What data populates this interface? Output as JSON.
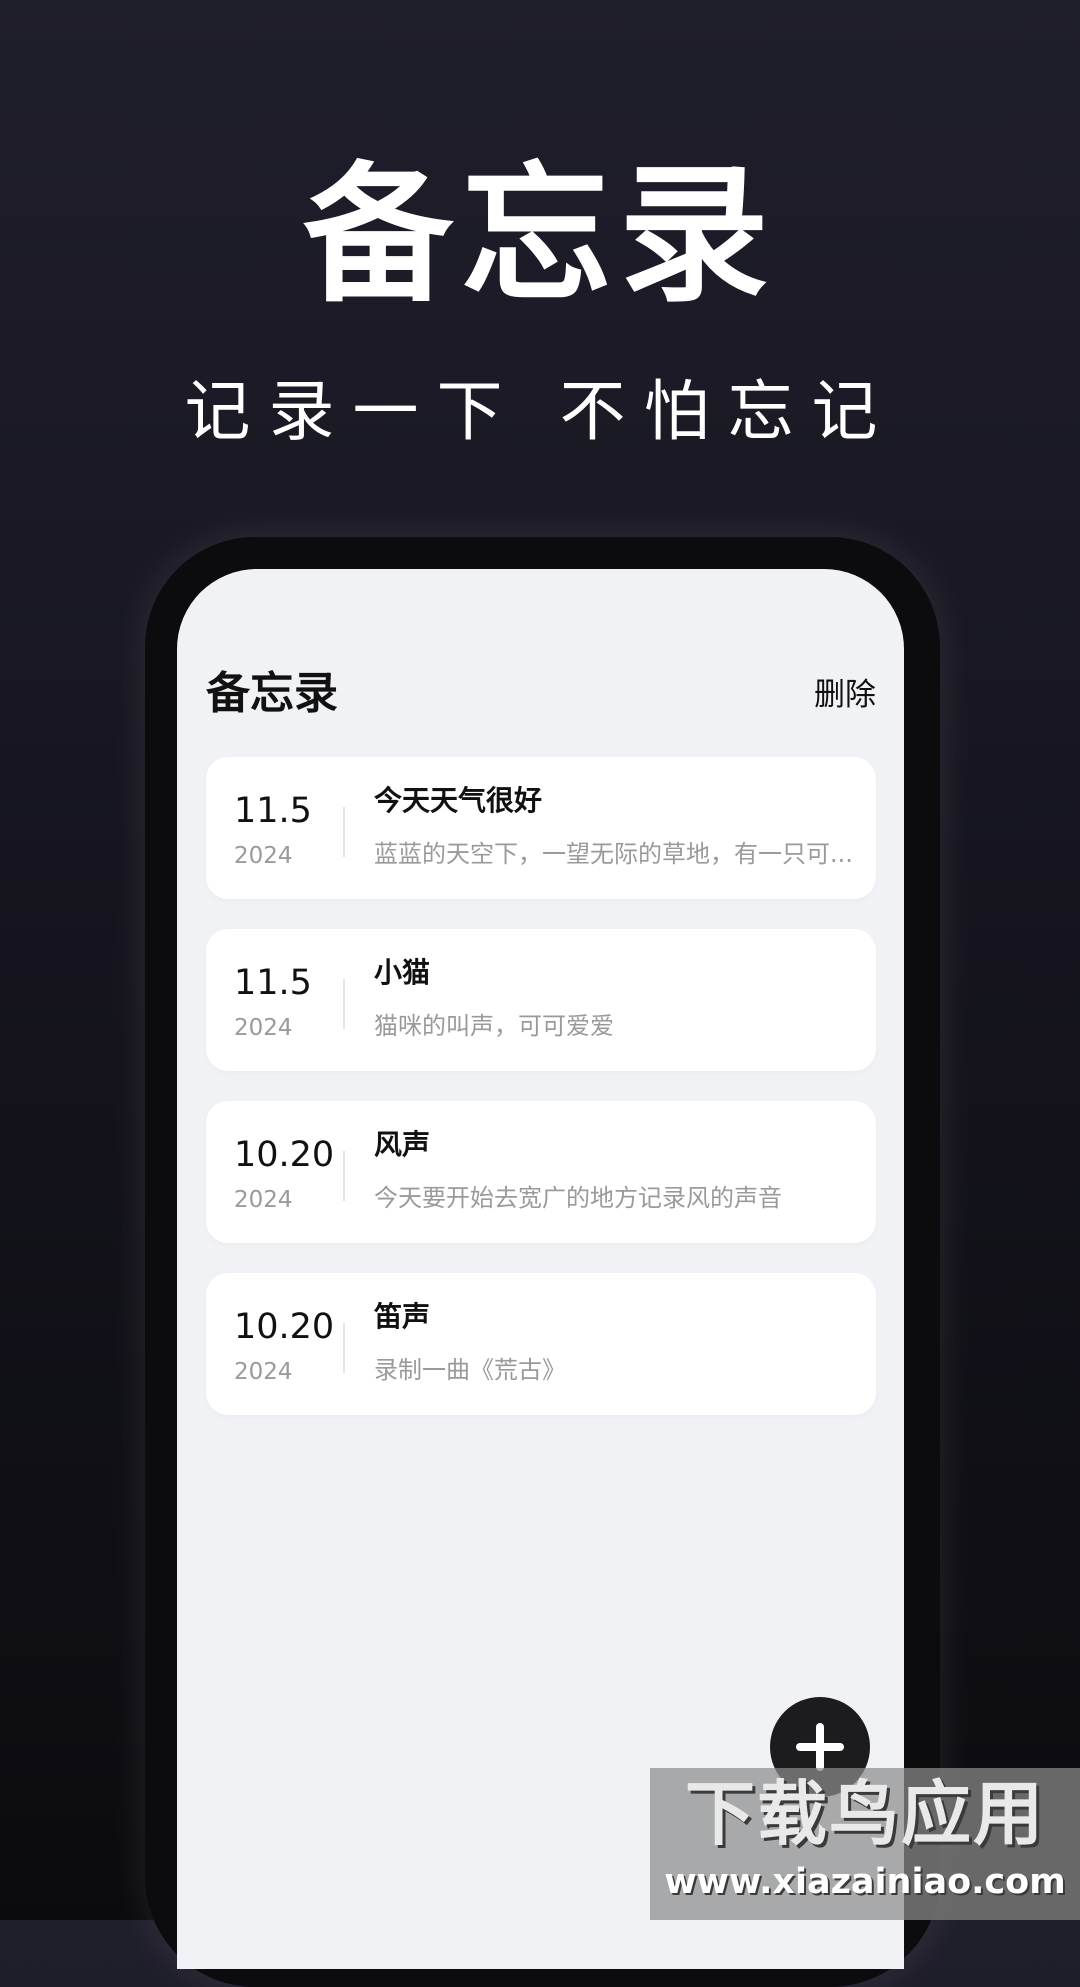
{
  "promo": {
    "title": "备忘录",
    "subtitle": "记录一下 不怕忘记"
  },
  "app": {
    "title": "备忘录",
    "delete_label": "删除"
  },
  "memos": [
    {
      "date": "11.5",
      "year": "2024",
      "title": "今天天气很好",
      "preview": "蓝蓝的天空下，一望无际的草地，有一只可..."
    },
    {
      "date": "11.5",
      "year": "2024",
      "title": "小猫",
      "preview": "猫咪的叫声，可可爱爱"
    },
    {
      "date": "10.20",
      "year": "2024",
      "title": "风声",
      "preview": "今天要开始去宽广的地方记录风的声音"
    },
    {
      "date": "10.20",
      "year": "2024",
      "title": "笛声",
      "preview": "录制一曲《荒古》"
    }
  ],
  "fab": {
    "icon": "plus-icon"
  },
  "watermark": {
    "main": "下载鸟应用",
    "url": "www.xiazainiao.com"
  }
}
